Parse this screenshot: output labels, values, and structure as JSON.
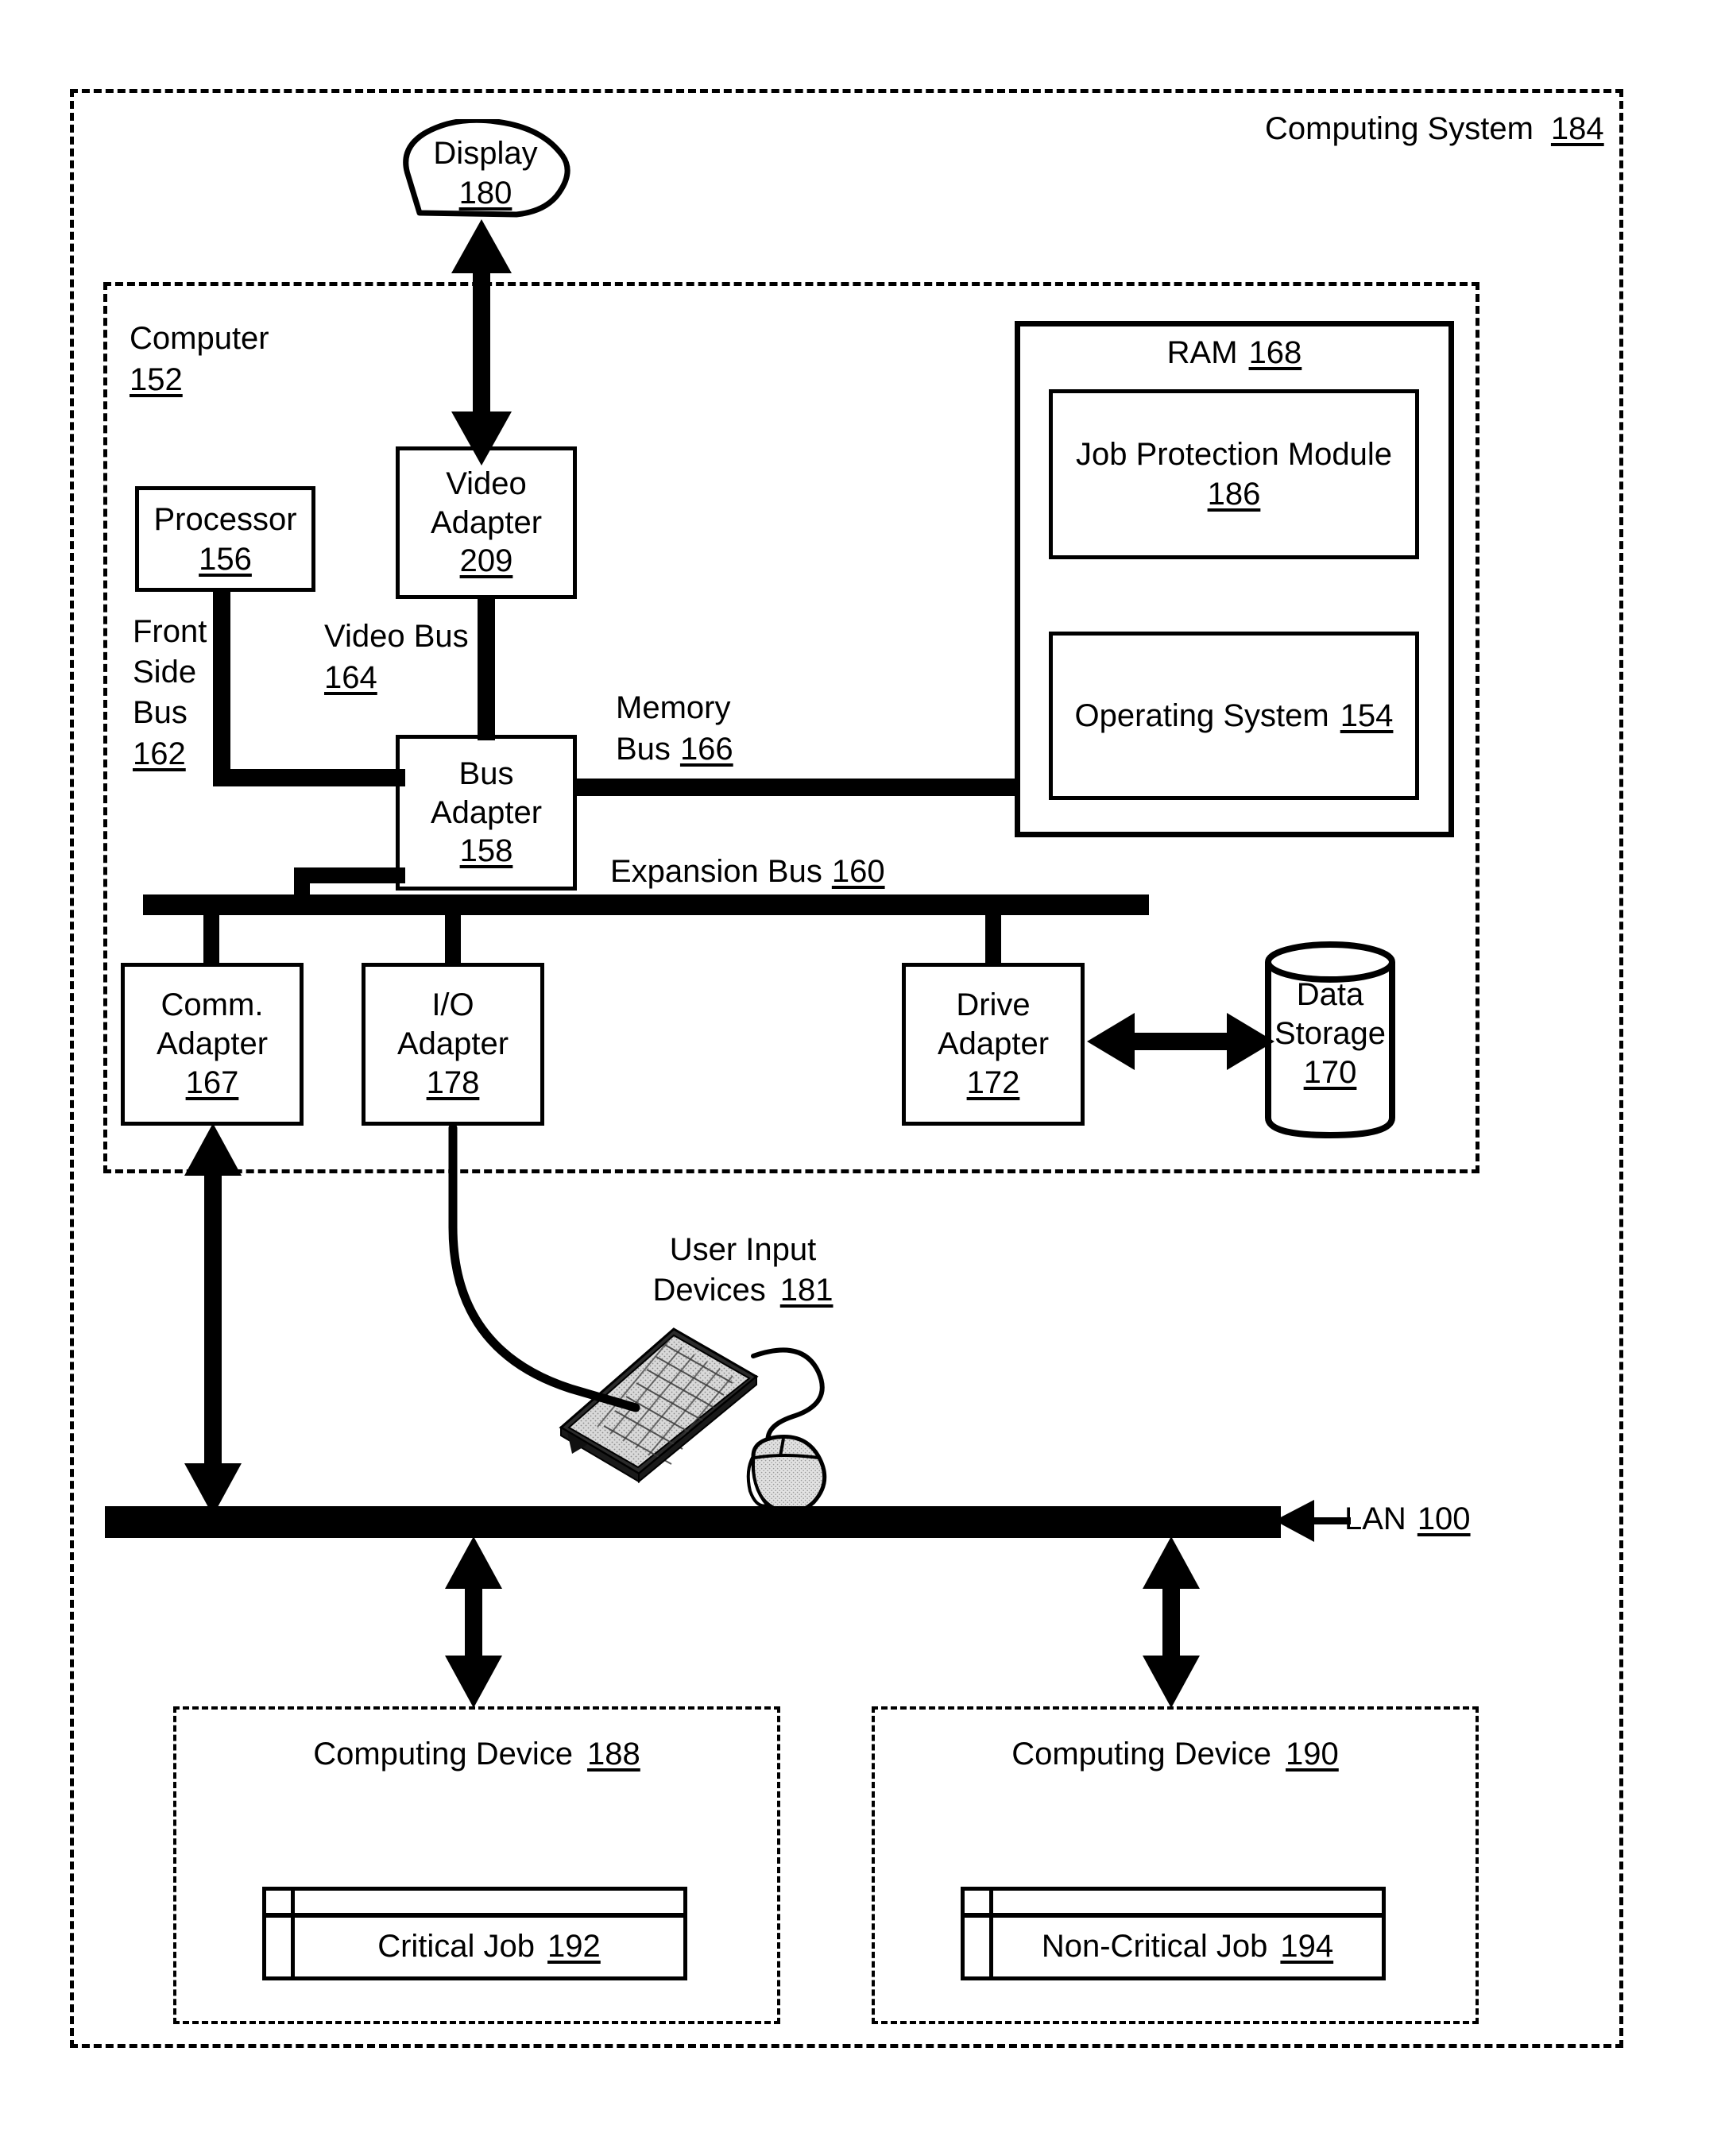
{
  "outer": {
    "title_text": "Computing System",
    "title_num": "184"
  },
  "display": {
    "label": "Display",
    "num": "180"
  },
  "computer": {
    "label": "Computer",
    "num": "152"
  },
  "ram": {
    "label": "RAM",
    "num": "168",
    "modules": [
      {
        "label": "Job Protection Module",
        "num": "186"
      },
      {
        "label": "Operating System",
        "num": "154"
      }
    ]
  },
  "processor": {
    "label": "Processor",
    "num": "156"
  },
  "video_adapter": {
    "line1": "Video",
    "line2": "Adapter",
    "num": "209"
  },
  "bus_adapter": {
    "line1": "Bus",
    "line2": "Adapter",
    "num": "158"
  },
  "buses": {
    "front_side": {
      "line1": "Front",
      "line2": "Side",
      "line3": "Bus",
      "num": "162"
    },
    "video": {
      "line1": "Video Bus",
      "num": "164"
    },
    "memory": {
      "line1": "Memory",
      "line2": "Bus",
      "num": "166"
    },
    "expansion": {
      "label": "Expansion Bus",
      "num": "160"
    }
  },
  "adapters": [
    {
      "line1": "Comm.",
      "line2": "Adapter",
      "num": "167"
    },
    {
      "line1": "I/O",
      "line2": "Adapter",
      "num": "178"
    },
    {
      "line1": "Drive",
      "line2": "Adapter",
      "num": "172"
    }
  ],
  "data_storage": {
    "line1": "Data",
    "line2": "Storage",
    "num": "170"
  },
  "user_input": {
    "line1": "User Input",
    "line2": "Devices",
    "num": "181"
  },
  "lan": {
    "label": "LAN",
    "num": "100"
  },
  "computing_devices": [
    {
      "label": "Computing Device",
      "num": "188",
      "job": {
        "label": "Critical Job",
        "num": "192"
      }
    },
    {
      "label": "Computing Device",
      "num": "190",
      "job": {
        "label": "Non-Critical Job",
        "num": "194"
      }
    }
  ],
  "colors": {
    "ink": "#000000",
    "paper": "#ffffff"
  }
}
